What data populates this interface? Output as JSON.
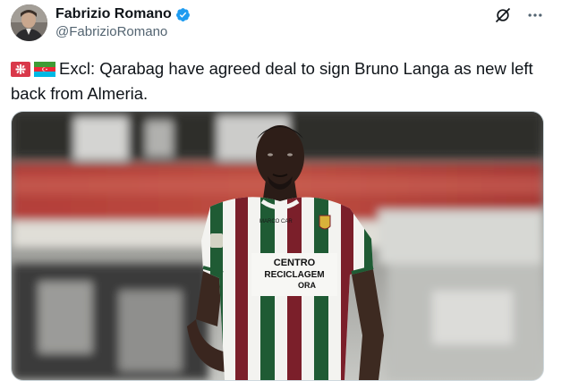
{
  "author": {
    "display_name": "Fabrizio Romano",
    "handle": "@FabrizioRomano",
    "verified": true
  },
  "tweet": {
    "text": "Excl: Qarabag have agreed deal to sign Bruno Langa as new left back from Almeria.",
    "emoji_flags": [
      "japanese-adult-sign-flag",
      "azerbaijan-flag"
    ]
  },
  "media": {
    "kit_sponsor_line1": "CENTRO",
    "kit_sponsor_line2": "RECICLAGEM",
    "kit_sponsor_line3": "ORA",
    "kit_sleeve_text": "MARCO CAR"
  },
  "colors": {
    "verified_blue": "#1d9bf0",
    "text_primary": "#0f1419",
    "text_secondary": "#536471",
    "kit_green": "#1f5b34",
    "kit_maroon": "#7b1f2a"
  },
  "icons": {
    "grok": "grok-icon",
    "more": "more-icon"
  }
}
